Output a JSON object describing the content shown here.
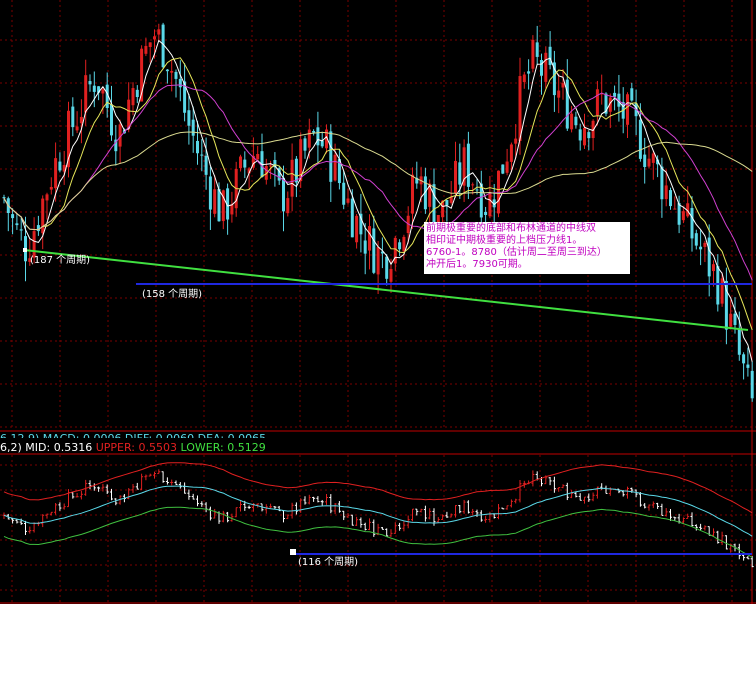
{
  "colors": {
    "background": "#000000",
    "grid": "#7a0000",
    "up": "#e02020",
    "down": "#5ad8e8",
    "ma5": "#ffffff",
    "ma10": "#e6e65a",
    "ma20": "#d040d0",
    "ma60": "#dada90",
    "green_line": "#40e040",
    "blue_line": "#1f28e0",
    "boll_upper": "#e02020",
    "boll_mid": "#5ad8e8",
    "boll_lower": "#40c040",
    "note_text": "#c000c0"
  },
  "main_panel": {
    "annotation": "前期极重要的底部和布林通道的中线双相印证中期极重要的上档压力线1。6760-1。8780（估计周二至周三到达）冲开后1。7930可期。",
    "annotation_lines": [
      "前期极重要的底部和布林通道的中线双",
      "相印证中期极重要的上档压力线1。",
      "6760-1。8780（估计周二至周三到达）",
      "冲开后1。7930可期。"
    ],
    "period_label_1": "(187 个周期)",
    "period_label_2": "(158 个周期)"
  },
  "sub_panel": {
    "macd_header": "6,12,9) MACD: 0.0006  DIFF: 0.0060  DEA: 0.0065",
    "boll_prefix": "6,2) MID: ",
    "mid_value": "0.5316",
    "upper_label": "UPPER: ",
    "upper_value": "0.5503",
    "lower_label": "LOWER: ",
    "lower_value": "0.5129",
    "period_label": "(116 个周期)"
  },
  "chart_data": {
    "type": "candlestick",
    "title": "",
    "candles_note": "close path approximated from the screenshot; values in chart units",
    "close_path": [
      1.0,
      0.92,
      0.88,
      0.96,
      1.05,
      1.12,
      1.18,
      1.24,
      1.3,
      1.22,
      1.15,
      1.25,
      1.33,
      1.4,
      1.36,
      1.28,
      1.18,
      1.1,
      1.02,
      0.96,
      1.02,
      1.08,
      1.12,
      1.06,
      1.0,
      1.04,
      1.1,
      1.15,
      1.12,
      1.05,
      0.98,
      0.92,
      0.88,
      0.85,
      0.9,
      0.97,
      1.05,
      1.0,
      0.96,
      1.02,
      1.08,
      1.04,
      0.98,
      1.05,
      1.15,
      1.26,
      1.33,
      1.3,
      1.26,
      1.22,
      1.18,
      1.2,
      1.24,
      1.22,
      1.2,
      1.16,
      1.1,
      1.05,
      1.0,
      0.95,
      0.9,
      0.85,
      0.8,
      0.7,
      0.6,
      0.5
    ],
    "lines": [
      {
        "name": "green_trendline",
        "from": [
          0,
          0.86
        ],
        "to": [
          65,
          0.72
        ]
      },
      {
        "name": "blue_resistance",
        "level": 0.78
      }
    ]
  }
}
